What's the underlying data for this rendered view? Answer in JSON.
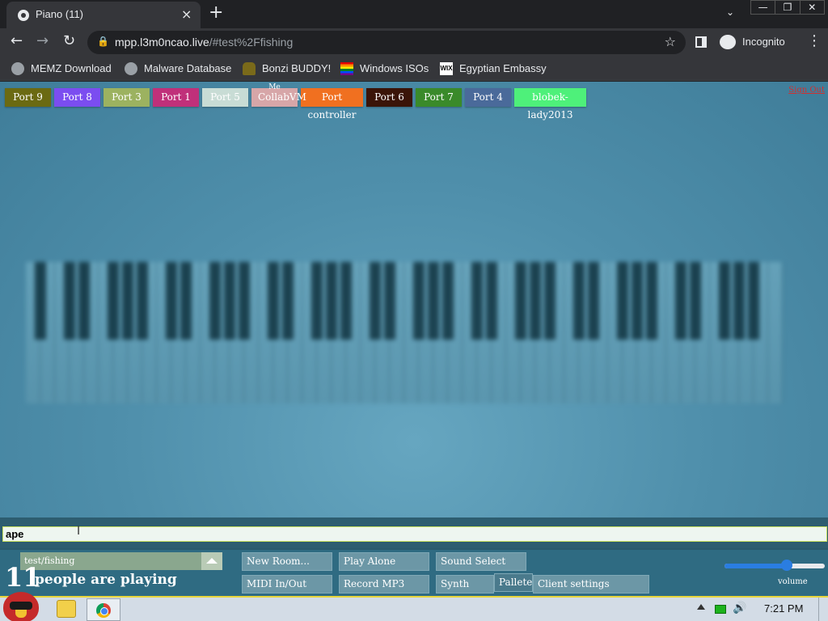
{
  "browser": {
    "tab_title": "Piano (11)",
    "tab_close": "×",
    "new_tab": "+",
    "tab_search": "⌄",
    "window": {
      "minimize": "—",
      "restore": "❐",
      "close": "✕"
    },
    "url_host": "mpp.l3m0ncao.live",
    "url_rest": "/#test%2Ffishing",
    "profile_label": "Incognito",
    "bookmarks": [
      {
        "label": "MEMZ Download",
        "icon": "globe-icon"
      },
      {
        "label": "Malware Database",
        "icon": "globe-icon"
      },
      {
        "label": "Bonzi BUDDY!",
        "icon": "bonzi-icon"
      },
      {
        "label": "Windows ISOs",
        "icon": "rainbow-flag-icon"
      },
      {
        "label": "Egyptian Embassy",
        "icon": "wix-icon"
      }
    ]
  },
  "page": {
    "ports": [
      {
        "label": "Port 9",
        "color": "#6b6a12"
      },
      {
        "label": "Port 8",
        "color": "#7b4df0"
      },
      {
        "label": "Port 3",
        "color": "#9cb260"
      },
      {
        "label": "Port 1",
        "color": "#c0307a"
      },
      {
        "label": "Port 5",
        "color": "#c8dcd5"
      },
      {
        "label": "CollabVM",
        "color": "#d7a6a8",
        "tag": "Me"
      },
      {
        "label": "Port controller",
        "color": "#f07020"
      },
      {
        "label": "Port 6",
        "color": "#3a1408"
      },
      {
        "label": "Port 7",
        "color": "#3a8a2a"
      },
      {
        "label": "Port 4",
        "color": "#4a6a9a"
      },
      {
        "label": "blobek-lady2013",
        "color": "#4ef07a"
      }
    ],
    "sign_out": "Sign Out",
    "chat_input_value": "ape",
    "room_name": "test/fishing",
    "people_count": "11",
    "people_label": "people are playing",
    "buttons": {
      "new_room": "New Room...",
      "play_alone": "Play Alone",
      "sound_select": "Sound Select",
      "midi": "MIDI In/Out",
      "record_mp3": "Record MP3",
      "synth": "Synth",
      "pallete": "Pallete",
      "client_settings": "Client settings"
    },
    "volume_label": "volume",
    "volume_level": 0.62
  },
  "taskbar": {
    "clock": "7:21 PM",
    "volume_icon": "🔊"
  }
}
